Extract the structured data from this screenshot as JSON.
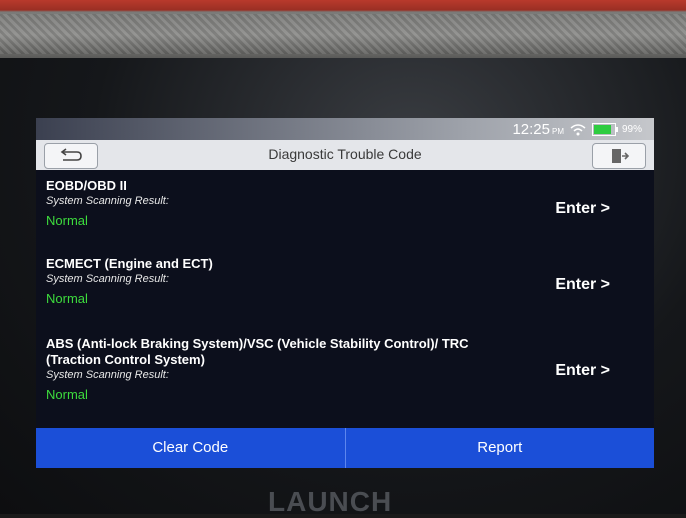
{
  "status_bar": {
    "time": "12:25",
    "ampm": "PM",
    "battery": "99%"
  },
  "header": {
    "title": "Diagnostic Trouble Code"
  },
  "items": [
    {
      "title": "EOBD/OBD II",
      "subtitle": "System Scanning Result:",
      "status": "Normal",
      "action": "Enter >"
    },
    {
      "title": "ECMECT (Engine and ECT)",
      "subtitle": "System Scanning Result:",
      "status": "Normal",
      "action": "Enter >"
    },
    {
      "title": "ABS (Anti-lock Braking System)/VSC (Vehicle Stability Control)/ TRC (Traction Control System)",
      "subtitle": "System Scanning Result:",
      "status": "Normal",
      "action": "Enter >"
    }
  ],
  "footer": {
    "clear_label": "Clear Code",
    "report_label": "Report"
  },
  "brand": "LAUNCH"
}
